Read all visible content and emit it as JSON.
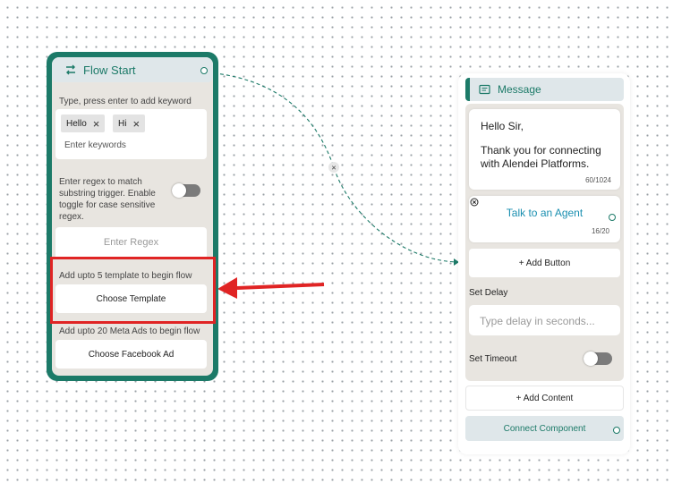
{
  "flow_start": {
    "title": "Flow Start",
    "keyword_hint": "Type, press enter to add keyword",
    "keywords": [
      "Hello",
      "Hi"
    ],
    "keyword_placeholder": "Enter keywords",
    "regex_hint": "Enter regex to match substring trigger. Enable toggle for case sensitive regex.",
    "regex_placeholder": "Enter Regex",
    "template_hint": "Add upto 5 template to begin flow",
    "template_button": "Choose Template",
    "ads_hint": "Add upto 20 Meta Ads to begin flow",
    "ads_button": "Choose Facebook Ad"
  },
  "message": {
    "title": "Message",
    "text_line1": "Hello Sir,",
    "text_line2": "Thank you for connecting with Alendei Platforms.",
    "text_counter": "60/1024",
    "button_label": "Talk to an Agent",
    "button_counter": "16/20",
    "add_button": "+ Add Button",
    "set_delay_label": "Set Delay",
    "delay_placeholder": "Type delay in seconds...",
    "set_timeout_label": "Set Timeout",
    "add_content": "+ Add Content",
    "connect_component": "Connect Component"
  },
  "edge": {
    "delete_symbol": "×"
  },
  "colors": {
    "accent": "#1c7a68",
    "highlight": "#e02424",
    "panel": "#e8e5e0",
    "header": "#dfe7ea"
  },
  "icons": [
    "flow-switch-icon",
    "message-icon",
    "close-icon",
    "remove-circle-icon"
  ]
}
